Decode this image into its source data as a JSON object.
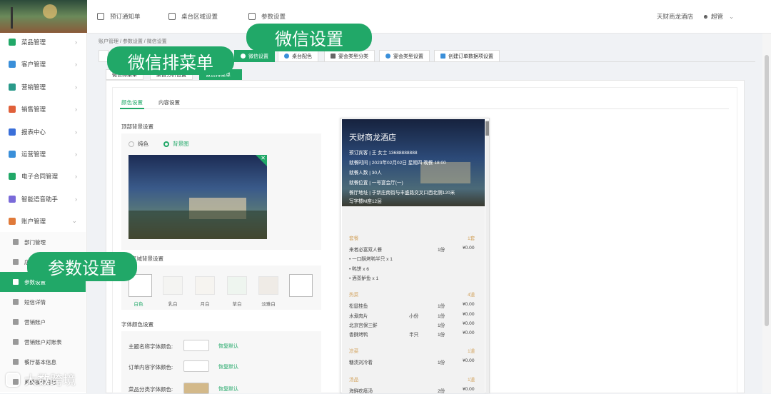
{
  "header": {
    "nav": [
      "预订通知单",
      "桌台区域设置",
      "参数设置"
    ],
    "hotel": "天财商龙酒店",
    "user": "超管"
  },
  "sidebar": {
    "items": [
      {
        "label": "菜品管理",
        "color": "#21a868"
      },
      {
        "label": "客户管理",
        "color": "#3a8fd9"
      },
      {
        "label": "营销管理",
        "color": "#2a9a8a"
      },
      {
        "label": "销售管理",
        "color": "#e0603a"
      },
      {
        "label": "报表中心",
        "color": "#3a6fd9"
      },
      {
        "label": "运营管理",
        "color": "#3a8fd9"
      },
      {
        "label": "电子合同管理",
        "color": "#21a868"
      },
      {
        "label": "智能语音助手",
        "color": "#7a6ad9"
      },
      {
        "label": "账户管理",
        "color": "#e07a3a"
      }
    ],
    "sub_items": [
      "部门管理",
      "店",
      "参数设置",
      "短信详情",
      "营销账户",
      "营销账户对账表",
      "餐厅基本信息",
      "系统操作日志"
    ]
  },
  "breadcrumb": "账户管理  /  参数设置  /  微信设置",
  "tabs": [
    "",
    "微信设置",
    "桌台配色",
    "宴会类型分类",
    "宴会类型设置",
    "创建订单数据项设置"
  ],
  "subtabs": [
    "微信排菜单",
    "桌台分析设置",
    "微信排菜单"
  ],
  "inner_tabs": [
    "颜色设置",
    "内容设置"
  ],
  "form": {
    "top_bg_label": "顶部背景设置",
    "radio_solid": "纯色",
    "radio_image": "背景图",
    "area_bg_label": "区域背景设置",
    "swatches": [
      {
        "label": "白色",
        "color": "#ffffff"
      },
      {
        "label": "乳白",
        "color": "#f4f4f2"
      },
      {
        "label": "月白",
        "color": "#f6f4f0"
      },
      {
        "label": "草白",
        "color": "#eef5ef"
      },
      {
        "label": "淡雅白",
        "color": "#efebe6"
      },
      {
        "label": "",
        "color": "#ffffff"
      }
    ],
    "font_color_label": "字体颜色设置",
    "font_rows": [
      {
        "label": "主题名称字体颜色:",
        "reset": "恢复默认",
        "color": "#ffffff"
      },
      {
        "label": "订单内容字体颜色:",
        "reset": "恢复默认",
        "color": "#ffffff"
      },
      {
        "label": "菜品分类字体颜色:",
        "reset": "恢复默认",
        "color": "#d3b98a"
      }
    ]
  },
  "preview": {
    "title": "天财商龙酒店",
    "lines": [
      "预订宾客 | 王 女士 13688888888",
      "就餐时间 | 2023年02月02日 星期四 晚餐 18:00",
      "就餐人数 | 30人",
      "就餐位置 | 一号宴会厅(一)",
      "餐厅地址 | 于新庄南街与丰盛路交叉口西北侧120米",
      "写字楼M座12层"
    ],
    "sections": [
      {
        "cat": "套餐",
        "count": "1套",
        "rows": [
          {
            "name": "来者必富双人餐",
            "spec": "",
            "qty": "1份",
            "price": "¥0.00"
          },
          {
            "name": "•  一口酥烤鸭半只 x 1",
            "spec": "",
            "qty": "",
            "price": ""
          },
          {
            "name": "•  鸭饼 x 6",
            "spec": "",
            "qty": "",
            "price": ""
          },
          {
            "name": "•  酒蒸鲈鱼 x 1",
            "spec": "",
            "qty": "",
            "price": ""
          }
        ]
      },
      {
        "cat": "热菜",
        "count": "4道",
        "rows": [
          {
            "name": "松鼠桂鱼",
            "spec": "",
            "qty": "1份",
            "price": "¥0.00"
          },
          {
            "name": "水煮肉片",
            "spec": "小份",
            "qty": "1份",
            "price": "¥0.00"
          },
          {
            "name": "北京宫保三鲜",
            "spec": "",
            "qty": "1份",
            "price": "¥0.00"
          },
          {
            "name": "香酥烤鸭",
            "spec": "半只",
            "qty": "1份",
            "price": "¥0.00"
          }
        ]
      },
      {
        "cat": "凉菜",
        "count": "1道",
        "rows": [
          {
            "name": "糖渍刘冷着",
            "spec": "",
            "qty": "1份",
            "price": "¥0.00"
          }
        ]
      },
      {
        "cat": "汤品",
        "count": "1道",
        "rows": [
          {
            "name": "海鲜疙瘩汤",
            "spec": "",
            "qty": "2份",
            "price": "¥0.00"
          }
        ]
      }
    ]
  },
  "callouts": {
    "wechat_settings": "微信设置",
    "wechat_menu": "微信排菜单",
    "param_settings": "参数设置"
  },
  "watermark": "大数跨境",
  "accent": "#21a868"
}
